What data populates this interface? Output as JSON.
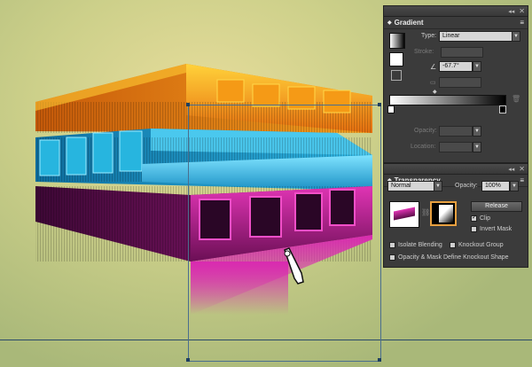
{
  "gradient_panel": {
    "title": "Gradient",
    "type_label": "Type:",
    "type_value": "Linear",
    "stroke_label": "Stroke:",
    "angle_value": "-67.7°",
    "opacity_label": "Opacity:",
    "location_label": "Location:"
  },
  "transparency_panel": {
    "title": "Transparency",
    "blend_mode": "Normal",
    "opacity_label": "Opacity:",
    "opacity_value": "100%",
    "release_label": "Release",
    "clip_label": "Clip",
    "invert_mask_label": "Invert Mask",
    "isolate_blending_label": "Isolate Blending",
    "knockout_group_label": "Knockout Group",
    "opacity_mask_label": "Opacity & Mask Define Knockout Shape"
  },
  "colors": {
    "canvas_center": "#e8dd9c",
    "canvas_edge": "#a9b879",
    "orange_layer": "#f39a1a",
    "cyan_layer": "#27b5df",
    "magenta_layer": "#c21a8e",
    "panel_bg": "#3b3b3b"
  },
  "icons": [
    "close-icon",
    "menu-icon",
    "collapse-arrow-icon",
    "swap-icon",
    "cursor-hand-icon",
    "trash-icon",
    "link-icon"
  ]
}
